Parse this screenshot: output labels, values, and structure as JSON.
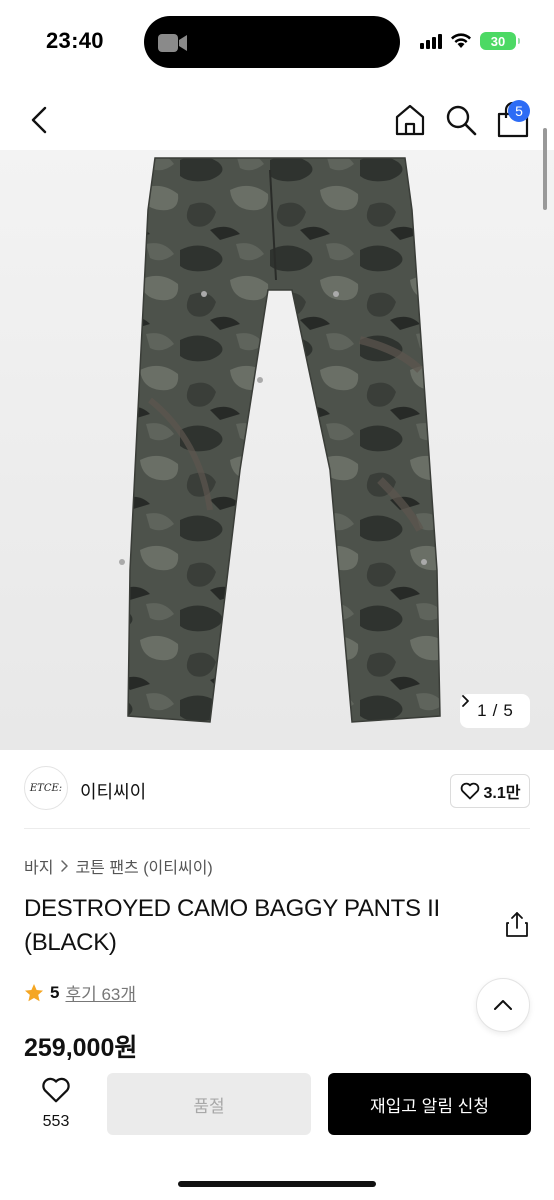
{
  "status_bar": {
    "time": "23:40",
    "battery": "30",
    "camera_icon": "video-camera-icon"
  },
  "nav": {
    "cart_count": "5",
    "icons": [
      "chevron-left-icon",
      "home-icon",
      "search-icon",
      "shopping-bag-icon"
    ]
  },
  "gallery": {
    "page_current": "1",
    "page_separator": "/",
    "page_total": "5"
  },
  "brand": {
    "logo_text": "ETCE:",
    "name": "이티씨이",
    "likes": "3.1만"
  },
  "breadcrumb": {
    "category": "바지",
    "subcategory": "코튼 팬츠 (이티씨이)"
  },
  "product": {
    "title": "DESTROYED CAMO BAGGY PANTS II (BLACK)",
    "rating": "5",
    "reviews": "후기 63개",
    "price": "259,000원"
  },
  "bottom": {
    "wishlist_count": "553",
    "soldout_label": "품절",
    "notify_label": "재입고 알림 신청"
  },
  "colors": {
    "accent_badge": "#2d6cf5",
    "star": "#f5a623",
    "primary_button": "#000000",
    "disabled_button": "#ebebeb"
  }
}
